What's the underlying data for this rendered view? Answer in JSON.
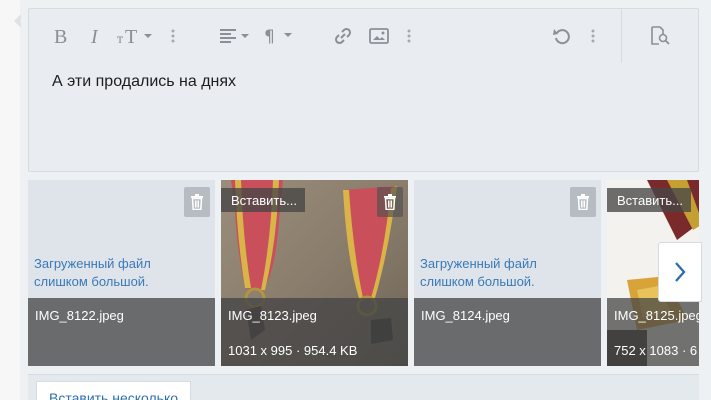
{
  "toolbar": {
    "items": [
      {
        "name": "bold-icon",
        "label": "B"
      },
      {
        "name": "italic-icon",
        "label": "I"
      },
      {
        "name": "font-size-icon",
        "label": "тT"
      }
    ]
  },
  "editor": {
    "content": "А эти продались на днях"
  },
  "attachments": [
    {
      "filename": "IMG_8122.jpeg",
      "error": "Загруженный файл слишком большой.",
      "dimensions": "",
      "has_insert": false
    },
    {
      "filename": "IMG_8123.jpeg",
      "error": "",
      "dimensions": "1031 x 995 · 954.4 KB",
      "has_insert": true,
      "insert_label": "Вставить..."
    },
    {
      "filename": "IMG_8124.jpeg",
      "error": "Загруженный файл слишком большой.",
      "dimensions": "",
      "has_insert": false
    },
    {
      "filename": "IMG_8125.jpeg",
      "error": "",
      "dimensions": "752 x 1083 · 6",
      "has_insert": true,
      "insert_label": "Вставить..."
    }
  ],
  "footer": {
    "insert_multiple_label": "Вставить несколько"
  },
  "colors": {
    "link": "#3a79b8",
    "toolbar_icon": "#8a9097",
    "editor_bg": "#e9edf1"
  }
}
